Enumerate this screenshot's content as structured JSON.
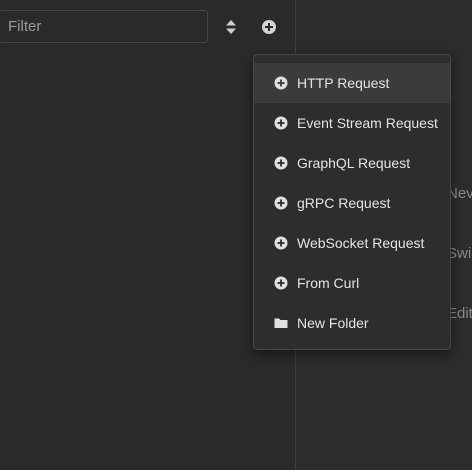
{
  "sidebar": {
    "filter_placeholder": "Filter"
  },
  "main": {
    "partial_labels": [
      "Nev",
      "Swi",
      "Edit"
    ]
  },
  "menu": {
    "items": [
      {
        "label": "HTTP Request",
        "icon": "plus-circle-icon"
      },
      {
        "label": "Event Stream Request",
        "icon": "plus-circle-icon"
      },
      {
        "label": "GraphQL Request",
        "icon": "plus-circle-icon"
      },
      {
        "label": "gRPC Request",
        "icon": "plus-circle-icon"
      },
      {
        "label": "WebSocket Request",
        "icon": "plus-circle-icon"
      },
      {
        "label": "From Curl",
        "icon": "plus-circle-icon"
      },
      {
        "label": "New Folder",
        "icon": "folder-icon"
      }
    ]
  },
  "colors": {
    "background": "#2b2b2b",
    "menu_background": "#2d2d2d",
    "menu_hover": "#3b3b3b",
    "text": "#e4e4e4",
    "muted_text": "#8a8a8a"
  }
}
